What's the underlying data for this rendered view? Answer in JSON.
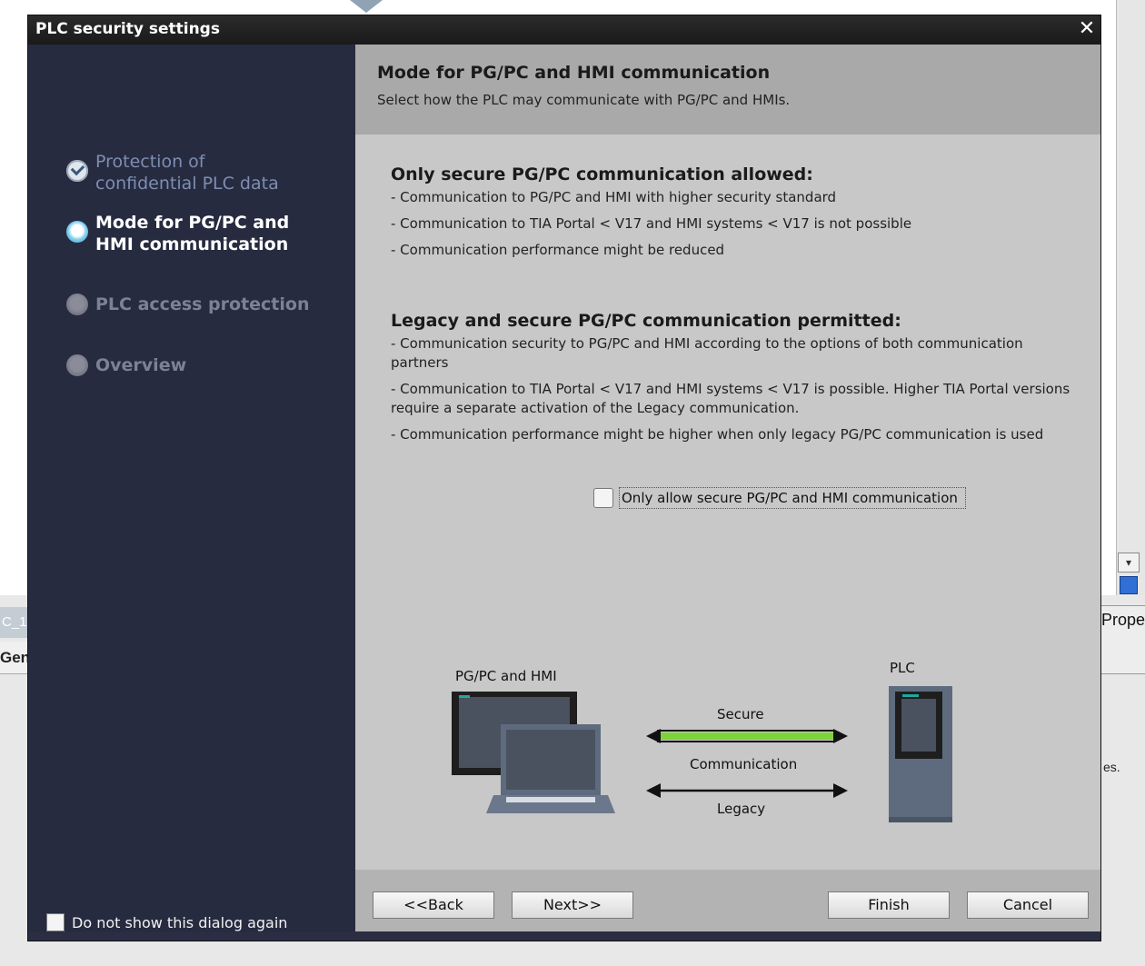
{
  "background": {
    "left_tab_text": "C_1",
    "left_tab2_text": "Gen",
    "right_panel_text": "Prope",
    "right_trailing_text": "es."
  },
  "dialog": {
    "title": "PLC security settings",
    "close_glyph": "✕"
  },
  "nav": {
    "items": [
      {
        "label": "Protection of confidential PLC data",
        "state": "done"
      },
      {
        "label": "Mode for PG/PC and HMI communication",
        "state": "current"
      },
      {
        "label": "PLC access protection",
        "state": "todo"
      },
      {
        "label": "Overview",
        "state": "todo"
      }
    ],
    "dont_show_label": "Do not show this dialog again"
  },
  "content": {
    "title": "Mode for PG/PC and HMI communication",
    "subtitle": "Select how the PLC may communicate with PG/PC and HMIs.",
    "secure_section": {
      "title": "Only secure PG/PC communication allowed:",
      "lines": [
        "- Communication to PG/PC and HMI with higher security standard",
        "- Communication to TIA Portal < V17 and HMI systems < V17 is not possible",
        "- Communication performance might be reduced"
      ]
    },
    "legacy_section": {
      "title": "Legacy and secure PG/PC communication permitted:",
      "lines": [
        "- Communication security to PG/PC and HMI according to the options of both communication partners",
        "- Communication to TIA Portal < V17 and HMI systems < V17 is possible. Higher TIA Portal versions require a separate activation of the Legacy communication.",
        "- Communication performance might be higher when only legacy PG/PC communication is used"
      ]
    },
    "secure_checkbox_label": "Only allow secure PG/PC and HMI communication",
    "secure_checkbox_checked": false
  },
  "diagram": {
    "pgpc_label": "PG/PC and HMI",
    "plc_label": "PLC",
    "secure_label": "Secure",
    "communication_label": "Communication",
    "legacy_label": "Legacy",
    "colors": {
      "secure_arrow": "#7dd23a",
      "device_dark": "#1e1e1e",
      "device_grey": "#5e6b7e",
      "accent": "#1fa8a0"
    }
  },
  "footer": {
    "back": "<<Back",
    "next": "Next>>",
    "finish": "Finish",
    "cancel": "Cancel"
  }
}
